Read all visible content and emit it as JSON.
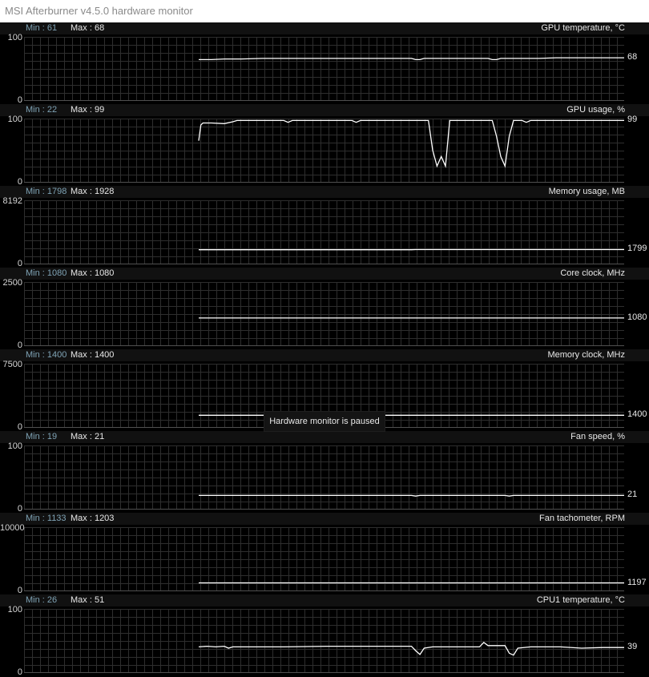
{
  "window": {
    "title": "MSI Afterburner v4.5.0 hardware monitor"
  },
  "tooltip": "Hardware monitor is paused",
  "graphs": [
    {
      "id": "gpu-temperature",
      "title": "GPU temperature, °C",
      "min_label": "Min : 61",
      "max_label": "Max : 68",
      "y_max_label": "100",
      "y_min_label": "0",
      "current": "68",
      "y_range": [
        0,
        100
      ],
      "series": [
        [
          0,
          64
        ],
        [
          3,
          64
        ],
        [
          6,
          65
        ],
        [
          10,
          65
        ],
        [
          15,
          66
        ],
        [
          20,
          66
        ],
        [
          35,
          66
        ],
        [
          45,
          66
        ],
        [
          50,
          66
        ],
        [
          51,
          64
        ],
        [
          52,
          64
        ],
        [
          53,
          66
        ],
        [
          60,
          66
        ],
        [
          67,
          66
        ],
        [
          68,
          66
        ],
        [
          69,
          64
        ],
        [
          70,
          64
        ],
        [
          71,
          66
        ],
        [
          80,
          66
        ],
        [
          84,
          67
        ],
        [
          85,
          67
        ],
        [
          100,
          67
        ]
      ]
    },
    {
      "id": "gpu-usage",
      "title": "GPU usage, %",
      "min_label": "Min : 22",
      "max_label": "Max : 99",
      "y_max_label": "100",
      "y_min_label": "0",
      "current": "99",
      "y_range": [
        0,
        100
      ],
      "series": [
        [
          0,
          65
        ],
        [
          0.5,
          90
        ],
        [
          1,
          93
        ],
        [
          3,
          93
        ],
        [
          6,
          92
        ],
        [
          8,
          95
        ],
        [
          9,
          97
        ],
        [
          20,
          97
        ],
        [
          21,
          94
        ],
        [
          22,
          97
        ],
        [
          36,
          97
        ],
        [
          37,
          94
        ],
        [
          38,
          97
        ],
        [
          54,
          97
        ],
        [
          55,
          50
        ],
        [
          56,
          25
        ],
        [
          57,
          40
        ],
        [
          58,
          25
        ],
        [
          59,
          97
        ],
        [
          69,
          97
        ],
        [
          70,
          72
        ],
        [
          71,
          40
        ],
        [
          72,
          25
        ],
        [
          73,
          72
        ],
        [
          74,
          97
        ],
        [
          76,
          97
        ],
        [
          77,
          94
        ],
        [
          78,
          97
        ],
        [
          100,
          97
        ]
      ]
    },
    {
      "id": "memory-usage",
      "title": "Memory usage, MB",
      "min_label": "Min : 1798",
      "max_label": "Max : 1928",
      "y_max_label": "8192",
      "y_min_label": "0",
      "current": "1799",
      "y_range": [
        0,
        8192
      ],
      "series": [
        [
          0,
          1799
        ],
        [
          50,
          1799
        ],
        [
          51,
          1815
        ],
        [
          100,
          1815
        ]
      ]
    },
    {
      "id": "core-clock",
      "title": "Core clock, MHz",
      "min_label": "Min : 1080",
      "max_label": "Max : 1080",
      "y_max_label": "2500",
      "y_min_label": "0",
      "current": "1080",
      "y_range": [
        0,
        2500
      ],
      "series": [
        [
          0,
          1080
        ],
        [
          100,
          1080
        ]
      ]
    },
    {
      "id": "memory-clock",
      "title": "Memory clock, MHz",
      "min_label": "Min : 1400",
      "max_label": "Max : 1400",
      "y_max_label": "7500",
      "y_min_label": "0",
      "current": "1400",
      "y_range": [
        0,
        7500
      ],
      "series": [
        [
          0,
          1400
        ],
        [
          100,
          1400
        ]
      ]
    },
    {
      "id": "fan-speed",
      "title": "Fan speed, %",
      "min_label": "Min : 19",
      "max_label": "Max : 21",
      "y_max_label": "100",
      "y_min_label": "0",
      "current": "21",
      "y_range": [
        0,
        100
      ],
      "series": [
        [
          0,
          21
        ],
        [
          50,
          21
        ],
        [
          51,
          20
        ],
        [
          52,
          21
        ],
        [
          72,
          21
        ],
        [
          73,
          20
        ],
        [
          74,
          21
        ],
        [
          100,
          21
        ]
      ]
    },
    {
      "id": "fan-tachometer",
      "title": "Fan tachometer, RPM",
      "min_label": "Min : 1133",
      "max_label": "Max : 1203",
      "y_max_label": "10000",
      "y_min_label": "0",
      "current": "1197",
      "y_range": [
        0,
        10000
      ],
      "series": [
        [
          0,
          1197
        ],
        [
          100,
          1197
        ]
      ]
    },
    {
      "id": "cpu1-temperature",
      "title": "CPU1 temperature, °C",
      "min_label": "Min : 26",
      "max_label": "Max : 51",
      "y_max_label": "100",
      "y_min_label": "0",
      "current": "39",
      "y_range": [
        0,
        100
      ],
      "series": [
        [
          0,
          40
        ],
        [
          2,
          41
        ],
        [
          4,
          40
        ],
        [
          6,
          41
        ],
        [
          7,
          38
        ],
        [
          8,
          40
        ],
        [
          20,
          40
        ],
        [
          30,
          41
        ],
        [
          40,
          41
        ],
        [
          50,
          41
        ],
        [
          51,
          34
        ],
        [
          52,
          28
        ],
        [
          53,
          38
        ],
        [
          55,
          40
        ],
        [
          60,
          40
        ],
        [
          66,
          40
        ],
        [
          67,
          47
        ],
        [
          68,
          42
        ],
        [
          72,
          42
        ],
        [
          73,
          30
        ],
        [
          74,
          27
        ],
        [
          75,
          38
        ],
        [
          78,
          40
        ],
        [
          85,
          40
        ],
        [
          90,
          38
        ],
        [
          95,
          39
        ],
        [
          100,
          39
        ]
      ]
    }
  ]
}
